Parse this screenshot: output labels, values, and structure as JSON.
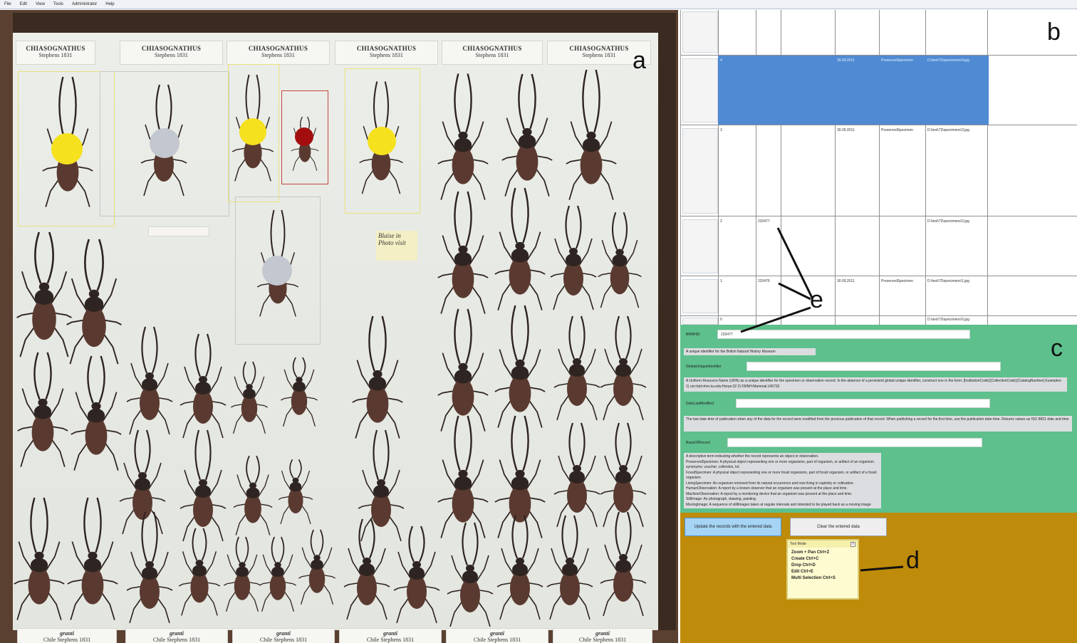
{
  "menubar": {
    "items": [
      "File",
      "Edit",
      "View",
      "Tools",
      "Administrator",
      "Help"
    ]
  },
  "drawer": {
    "header_labels": [
      {
        "genus": "CHIASOGNATHUS",
        "author": "Stephens 1831"
      },
      {
        "genus": "CHIASOGNATHUS",
        "author": "Stephens 1831"
      },
      {
        "genus": "CHIASOGNATHUS",
        "author": "Stephens 1831"
      },
      {
        "genus": "CHIASOGNATHUS",
        "author": "Stephens 1831"
      },
      {
        "genus": "CHIASOGNATHUS",
        "author": "Stephens 1831"
      },
      {
        "genus": "CHIASOGNATHUS",
        "author": "Stephens 1831"
      }
    ],
    "footer_labels": [
      {
        "species": "granti",
        "locality": "Chile  Stephens 1831"
      },
      {
        "species": "granti",
        "locality": "Chile  Stephens 1831"
      },
      {
        "species": "granti",
        "locality": "Chile  Stephens 1831"
      },
      {
        "species": "granti",
        "locality": "Chile  Stephens 1831"
      },
      {
        "species": "granti",
        "locality": "Chile  Stephens 1831"
      },
      {
        "species": "granti",
        "locality": "Chile  Stephens 1831"
      }
    ],
    "handwritten_note": "Blaise in Photo visit"
  },
  "figure_letters": {
    "a": "a",
    "b": "b",
    "c": "c",
    "d": "d",
    "e": "e"
  },
  "table": {
    "rows": [
      {
        "id": "",
        "barcode": "",
        "date": "",
        "basis": "",
        "file": ""
      },
      {
        "id": "4",
        "barcode": "",
        "date": "30.09.2011",
        "basis": "PreservedSpecimen",
        "file": "D:\\test\\73\\specimens\\4.jpg"
      },
      {
        "id": "3",
        "barcode": "",
        "date": "30.09.2011",
        "basis": "PreservedSpecimen",
        "file": "D:\\test\\73\\specimens\\3.jpg"
      },
      {
        "id": "2",
        "barcode": "233477",
        "date": "",
        "basis": "",
        "file": "D:\\test\\73\\specimens\\2.jpg"
      },
      {
        "id": "1",
        "barcode": "233476",
        "date": "30.09.2011",
        "basis": "PreservedSpecimen",
        "file": "D:\\test\\73\\specimens\\1.jpg"
      },
      {
        "id": "0",
        "barcode": "",
        "date": "",
        "basis": "",
        "file": "D:\\test\\73\\specimens\\0.jpg"
      }
    ]
  },
  "form": {
    "fields": [
      {
        "label": "BMNHID",
        "value": "233477",
        "description": "A unique identifier for the British Natural History Museum"
      },
      {
        "label": "GlobalUniqueIdentifier",
        "value": "",
        "description": "A Uniform Resource Name (URN) as a unique identifier for the specimen or observation record. In the absence of a persistent global unique identifier, construct one in the form: [InstitutionCode]:[CollectionCode]:[CatalogNumber] Examples: 1) urn:lsid:nhm.ku.edu:Herps:32 2) FMNH:Mammal:145732"
      },
      {
        "label": "DateLastModified",
        "value": "",
        "description": "The last date-time of publication when any of the data for the record were modified from the previous publication of that record. When publishing a record for the first time, use the publication date-time. Returns values as ISO 8601 date and time"
      },
      {
        "label": "BasisOfRecord",
        "value": "",
        "description": "A descriptive term indicating whether the record represents an object or observation."
      }
    ],
    "basis_lines": [
      "PreservedSpecimen: A physical object representing one or more organisms, part of organism, or artifact of an organism. synonyms: voucher, collection, lot.",
      "FossilSpecimen: A physical object representing one or more fossil organisms, part of fossil organism, or artifact of a fossil organism.",
      "LivingSpecimen: An organism removed from its natural occurrence and now living in captivity or cultivation.",
      "HumanObservation: A report by a known observer that an organism was present at the place and time.",
      "MachineObservation: A report by a monitoring device that an organism was present at the place and time.",
      "StillImage: An photograph, drawing, painting.",
      "MovingImage: A sequence of stillImages taken at regular intervals and intended to be played back as a moving image"
    ]
  },
  "actions": {
    "update_label": "Update the records with the entered data",
    "clear_label": "Clear the entered data"
  },
  "toolmode": {
    "title": "Tool Mode",
    "close": "x",
    "items": [
      "Zoom + Pan  Ctrl+Z",
      "Create  Ctrl+C",
      "Drop  Ctrl+D",
      "Edit  Ctrl+E",
      "Multi Selection  Ctrl+S"
    ]
  },
  "colors": {
    "selected_row": "#4f8ad3",
    "form_bg": "#5ec08d",
    "action_bg": "#bf8b0a",
    "dot_yellow": "#f5e11d",
    "dot_grey": "#c3c7cf",
    "dot_red": "#a30d0d"
  }
}
